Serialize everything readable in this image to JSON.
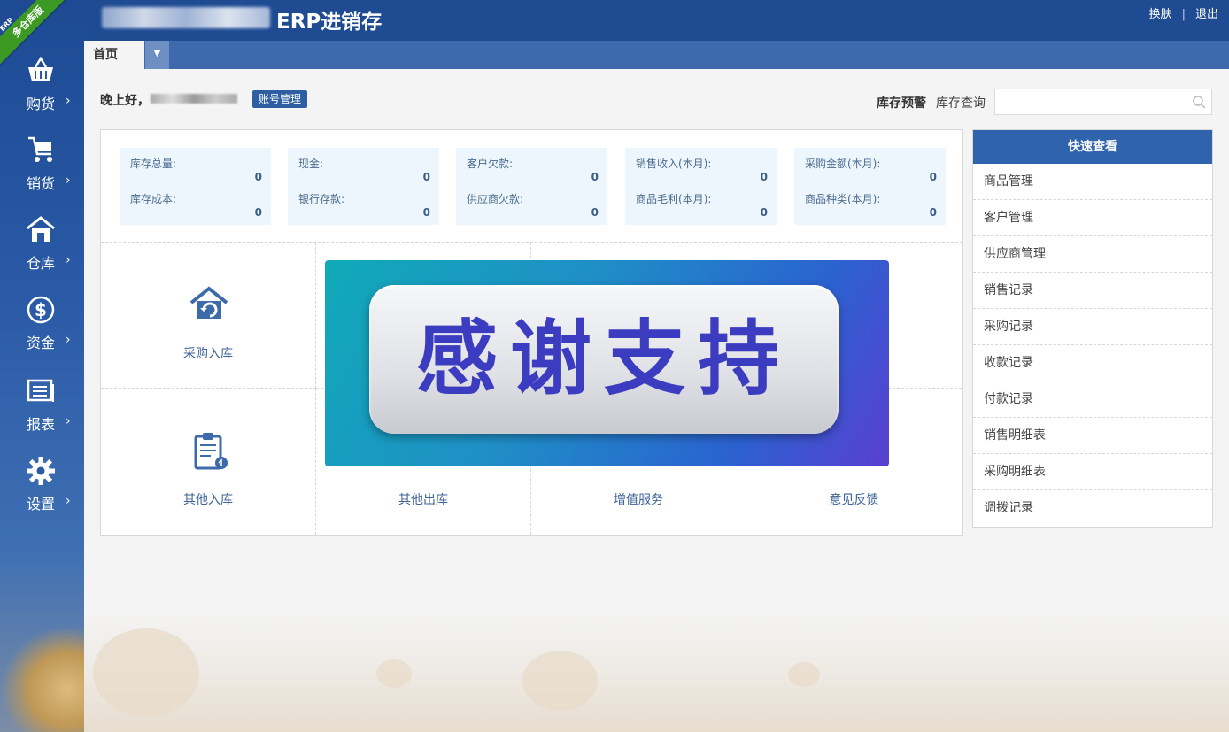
{
  "sidebar": {
    "badge_top": "ERP",
    "badge": "多仓库版",
    "items": [
      {
        "label": "购货",
        "icon": "basket-icon"
      },
      {
        "label": "销货",
        "icon": "cart-icon"
      },
      {
        "label": "仓库",
        "icon": "warehouse-icon"
      },
      {
        "label": "资金",
        "icon": "dollar-icon"
      },
      {
        "label": "报表",
        "icon": "report-icon"
      },
      {
        "label": "设置",
        "icon": "gear-icon"
      }
    ],
    "arrow": "›"
  },
  "header": {
    "title": "ERP进销存",
    "links": [
      "换肤",
      "退出"
    ]
  },
  "tabs": [
    {
      "label": "首页"
    }
  ],
  "greeting": {
    "text": "晚上好，",
    "account_button": "账号管理"
  },
  "toolbar": {
    "stock_alert": "库存预警",
    "stock_query": "库存查询",
    "search": {
      "value": "",
      "placeholder": ""
    }
  },
  "stats": [
    {
      "rows": [
        {
          "label": "库存总量:",
          "value": "0"
        },
        {
          "label": "库存成本:",
          "value": "0"
        }
      ]
    },
    {
      "rows": [
        {
          "label": "现金:",
          "value": "0"
        },
        {
          "label": "银行存款:",
          "value": "0"
        }
      ]
    },
    {
      "rows": [
        {
          "label": "客户欠款:",
          "value": "0"
        },
        {
          "label": "供应商欠款:",
          "value": "0"
        }
      ]
    },
    {
      "rows": [
        {
          "label": "销售收入(本月):",
          "value": "0"
        },
        {
          "label": "商品毛利(本月):",
          "value": "0"
        }
      ]
    },
    {
      "rows": [
        {
          "label": "采购金额(本月):",
          "value": "0"
        },
        {
          "label": "商品种类(本月):",
          "value": "0"
        }
      ]
    }
  ],
  "tiles": [
    {
      "label": "采购入库",
      "icon": "purchase-in-icon"
    },
    {
      "label": "",
      "icon": ""
    },
    {
      "label": "",
      "icon": ""
    },
    {
      "label": "",
      "icon": ""
    },
    {
      "label": "其他入库",
      "icon": "clipboard-icon"
    },
    {
      "label": "其他出库",
      "icon": ""
    },
    {
      "label": "增值服务",
      "icon": ""
    },
    {
      "label": "意见反馈",
      "icon": ""
    }
  ],
  "banner": {
    "text": "感谢支持"
  },
  "quick": {
    "title": "快速查看",
    "items": [
      "商品管理",
      "客户管理",
      "供应商管理",
      "销售记录",
      "采购记录",
      "收款记录",
      "付款记录",
      "销售明细表",
      "采购明细表",
      "调拨记录"
    ]
  },
  "colors": {
    "primary": "#1f4b93",
    "accent": "#2f64ad",
    "tile_text": "#3d6297"
  }
}
